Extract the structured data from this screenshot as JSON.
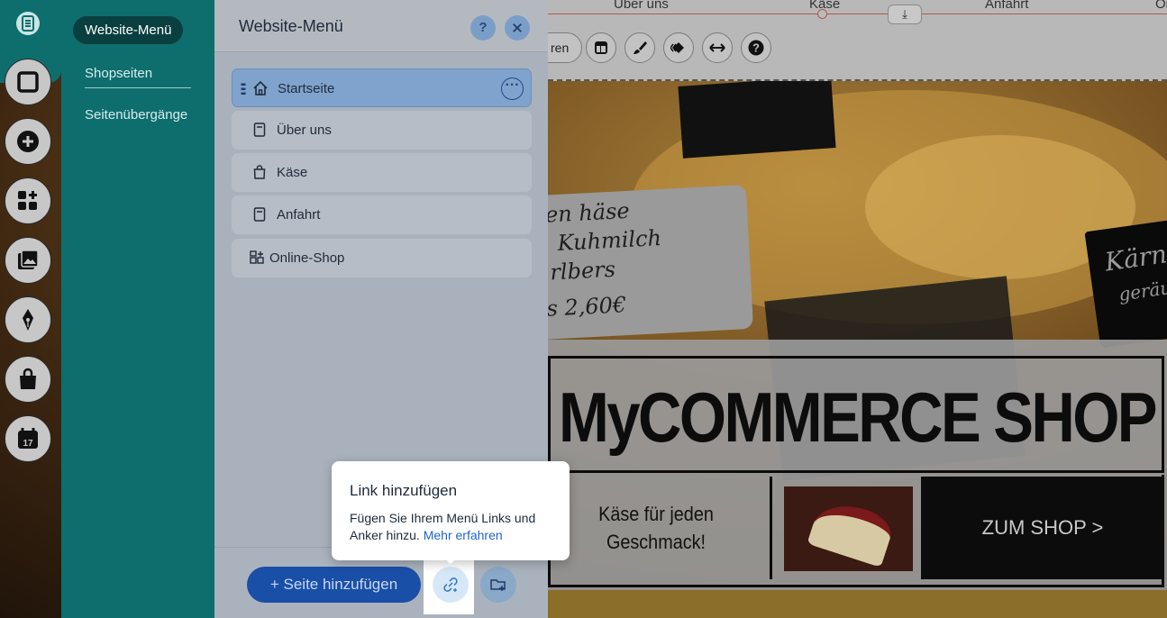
{
  "site_nav": {
    "links": [
      "Über uns",
      "Käse",
      "Anfahrt",
      "On"
    ],
    "tool_pill_label": "ren"
  },
  "nav_column": {
    "items": [
      "Website-Menü",
      "Shopseiten",
      "Seitenübergänge"
    ]
  },
  "panel": {
    "title": "Website-Menü",
    "help_label": "?",
    "pages": [
      {
        "label": "Startseite",
        "icon": "home-icon"
      },
      {
        "label": "Über uns",
        "icon": "page-icon"
      },
      {
        "label": "Käse",
        "icon": "shopping-bag-icon"
      },
      {
        "label": "Anfahrt",
        "icon": "page-icon"
      },
      {
        "label": "Online-Shop",
        "icon": "shop-grid-icon"
      }
    ],
    "more_label": "···",
    "add_page_label": "+ Seite hinzufügen"
  },
  "tooltip": {
    "title": "Link hinzufügen",
    "text": "Fügen Sie Ihrem Menü Links und Anker hinzu.",
    "link_text": "Mehr erfahren"
  },
  "site": {
    "shop_title": "MyCOMMERCE SHOP",
    "tagline": "Käse für jeden Geschmack!",
    "cta": "ZUM SHOP >",
    "price_text": [
      "en häse",
      "Kuhmilch",
      "rlbers",
      "s  2,60€"
    ],
    "board_text": [
      "Kärn",
      "geräu"
    ]
  },
  "colors": {
    "teal": "#0e6e6e",
    "primary_blue": "#1a4fa8",
    "link_blue": "#1e63d6"
  }
}
